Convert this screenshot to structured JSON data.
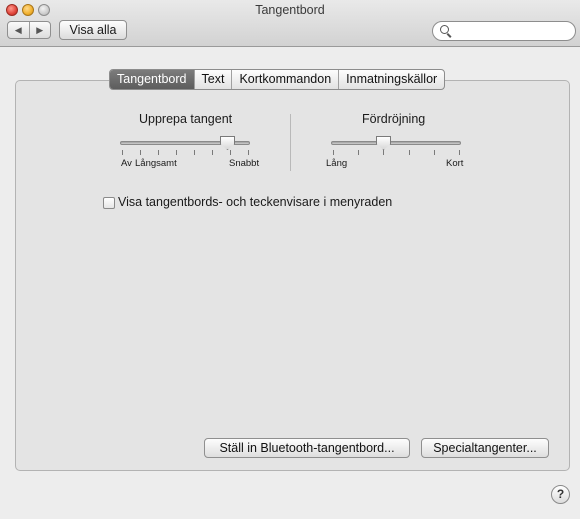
{
  "window": {
    "title": "Tangentbord"
  },
  "toolbar": {
    "back_glyph": "◀",
    "forward_glyph": "▶",
    "show_all_label": "Visa alla",
    "search_placeholder": "",
    "search_value": ""
  },
  "tabs": [
    {
      "label": "Tangentbord",
      "selected": true
    },
    {
      "label": "Text",
      "selected": false
    },
    {
      "label": "Kortkommandon",
      "selected": false
    },
    {
      "label": "Inmatningskällor",
      "selected": false
    }
  ],
  "key_repeat": {
    "title": "Upprepa tangent",
    "min_label_1": "Av",
    "min_label_2": "Långsamt",
    "max_label": "Snabbt",
    "level_fraction": 0.82,
    "tick_count": 8
  },
  "delay_until_repeat": {
    "title": "Fördröjning",
    "min_label": "Lång",
    "max_label": "Kort",
    "level_fraction": 0.4,
    "tick_count": 6
  },
  "show_viewer_checkbox": {
    "label": "Visa tangentbords- och teckenvisare i menyraden",
    "checked": false
  },
  "buttons": {
    "bluetooth_label": "Ställ in Bluetooth-tangentbord...",
    "modifier_label": "Specialtangenter..."
  },
  "help_label": "?"
}
